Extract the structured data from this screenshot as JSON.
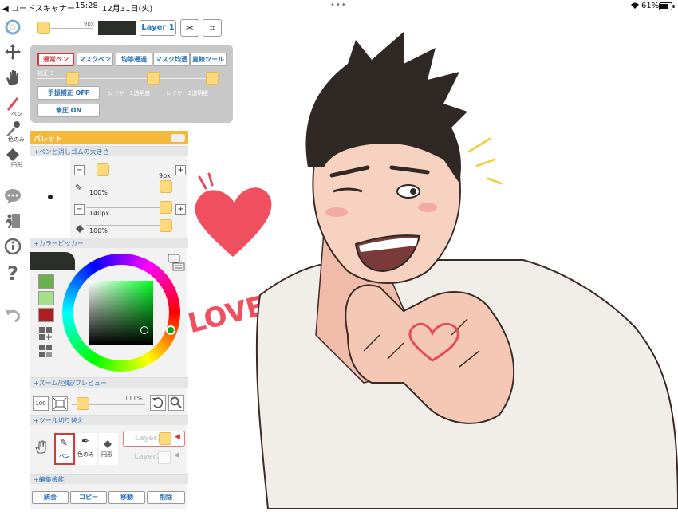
{
  "status_bar": {
    "app_back": "◀ コードスキャナー",
    "time": "15:28",
    "date": "12月31日(火)",
    "battery": "61%",
    "wifi_icon": "wifi-icon",
    "battery_icon": "battery-icon"
  },
  "toolbar": {
    "brush_size": "9px",
    "color_hex": "#2b2f2a",
    "layer_button": "Layer 1"
  },
  "left_tools": [
    {
      "name": "color-wheel-icon",
      "label": ""
    },
    {
      "name": "move-icon",
      "label": ""
    },
    {
      "name": "hand-icon",
      "label": ""
    },
    {
      "name": "pen-icon",
      "label": "ペン"
    },
    {
      "name": "eyedropper-icon",
      "label": "色のみ"
    },
    {
      "name": "eraser-icon",
      "label": "円形"
    },
    {
      "name": "chat-icon",
      "label": ""
    },
    {
      "name": "exit-icon",
      "label": ""
    },
    {
      "name": "info-icon",
      "label": ""
    },
    {
      "name": "help-icon",
      "label": ""
    },
    {
      "name": "undo-icon",
      "label": ""
    }
  ],
  "pen_panel": {
    "modes": [
      "通常ペン",
      "マスクペン",
      "均等通過",
      "マスク均透",
      "直線ツール"
    ],
    "correction_label": "補正 9",
    "hand_correction": "手振補正 OFF",
    "layer1_opacity": "レイヤー1透明度",
    "layer2_opacity": "レイヤー2透明度",
    "pressure": "筆圧 ON"
  },
  "palette": {
    "title": "パレット",
    "section_brush": "+ペンと消しゴムの大きさ",
    "pen_size": "9px",
    "pen_opacity": "100%",
    "eraser_size": "140px",
    "eraser_opacity": "100%",
    "section_color": "+カラーピッカー",
    "swatches": [
      "#6ab04c",
      "#a8e08a",
      "#b01e22"
    ],
    "section_zoom": "+ズーム/回転/プレビュー",
    "zoom_100": "100",
    "zoom_level": "111%",
    "section_tools": "+ツール切り替え",
    "tool_pen": "ペン",
    "tool_color": "色のみ",
    "tool_circle": "円形",
    "layer_a": "Layer1",
    "layer_b": "Layer2",
    "section_edit": "+編集機能",
    "edit_buttons": [
      "統合",
      "コピー",
      "移動",
      "削除"
    ]
  },
  "canvas": {
    "love_text": "LOVE"
  }
}
